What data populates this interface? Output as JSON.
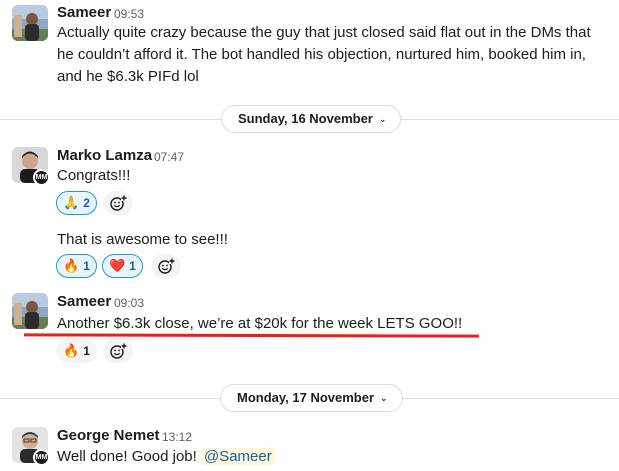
{
  "messages": {
    "m1": {
      "author": "Sameer",
      "time": "09:53",
      "line1": "Actually quite crazy because the guy that just closed said flat out in the DMs that",
      "line2": "he couldn’t afford it. The bot handled his objection, nurtured him, booked him in,",
      "line3": "and he $6.3k PIFd lol"
    },
    "m2": {
      "author": "Marko Lamza",
      "time": "07:47",
      "badge": "MM",
      "text": "Congrats!!!",
      "reaction_emoji": "🙏",
      "reaction_count": "2"
    },
    "m3": {
      "text": "That is awesome to see!!!",
      "reactions": [
        {
          "emoji": "🔥",
          "count": "1"
        },
        {
          "emoji": "❤️",
          "count": "1"
        }
      ]
    },
    "m4": {
      "author": "Sameer",
      "time": "09:03",
      "text": "Another $6.3k close, we’re at $20k for the week LETS GOO!!",
      "reaction_emoji": "🔥",
      "reaction_count": "1"
    },
    "m5": {
      "author": "George Nemet",
      "time": "13:12",
      "badge": "MM",
      "text": "Well done! Good job!",
      "mention": "@Sameer"
    }
  },
  "dividers": {
    "d1": "Sunday, 16 November",
    "d2": "Monday, 17 November"
  },
  "colors": {
    "accent_blue": "#1264a3",
    "highlight_red": "#e8201a"
  }
}
